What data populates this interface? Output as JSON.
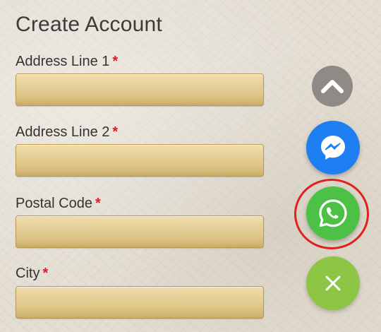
{
  "form": {
    "title": "Create Account",
    "fields": [
      {
        "label": "Address Line 1",
        "required_mark": "*",
        "value": ""
      },
      {
        "label": "Address Line 2",
        "required_mark": "*",
        "value": ""
      },
      {
        "label": "Postal Code",
        "required_mark": "*",
        "value": ""
      },
      {
        "label": "City",
        "required_mark": "*",
        "value": ""
      }
    ]
  },
  "floating_actions": {
    "buttons": [
      {
        "icon": "chevron-up-icon",
        "color": "#8f8a86"
      },
      {
        "icon": "messenger-icon",
        "color": "#1d7ff2"
      },
      {
        "icon": "whatsapp-icon",
        "color": "#4cc146",
        "highlighted": true
      },
      {
        "icon": "close-icon",
        "color": "#8dc545"
      }
    ],
    "highlight_color": "#e02121"
  },
  "colors": {
    "required": "#e1192a",
    "input_gold": "#e0c88c"
  }
}
